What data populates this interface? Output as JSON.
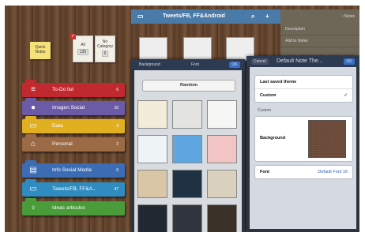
{
  "sidebar": {
    "sticky_label": "Quick Notes",
    "tile_all_label": "All",
    "tile_all_count": "135",
    "tile_nocat_label": "No Category",
    "tile_nocat_count": "6",
    "folders": [
      {
        "label": "To-Do list",
        "count": "6",
        "color": "#c0292f"
      },
      {
        "label": "Imagen Social",
        "count": "26",
        "color": "#6b5aa6"
      },
      {
        "label": "Data",
        "count": "3",
        "color": "#e0b020"
      },
      {
        "label": "Personal",
        "count": "2",
        "color": "#9c6a44"
      },
      {
        "label": "Info Social Media",
        "count": "6",
        "color": "#3b6cb4"
      },
      {
        "label": "Tweets/FB, FF&A...",
        "count": "47",
        "color": "#2f8cc0"
      },
      {
        "label": "Ideas articulos",
        "count": "",
        "color": "#4a9b3a"
      }
    ]
  },
  "header": {
    "title": "Tweets/FB, FF&Android",
    "notes_label": "Notes",
    "list_items": [
      "Description",
      "Add to Notes"
    ]
  },
  "background_popover": {
    "tab_background": "Background",
    "tab_font": "Font",
    "ok_label": "OK",
    "random_label": "Random",
    "swatches": [
      "#f3ecd8",
      "#e3e3e0",
      "#f6f6f4",
      "#eef3f6",
      "#5ea7e0",
      "#f3c4c4",
      "#d8c6a6",
      "#1f3244",
      "#d9d0bd",
      "#222831",
      "#30353f",
      "#3a3128"
    ]
  },
  "note_theme_popover": {
    "cancel_label": "Cancel",
    "title": "Default Note The...",
    "ok_label": "OK",
    "last_saved_label": "Last saved theme",
    "custom_label": "Custom",
    "section_custom": "Custom",
    "background_label": "Background",
    "font_label": "Font",
    "font_value": "Default Font 16"
  }
}
